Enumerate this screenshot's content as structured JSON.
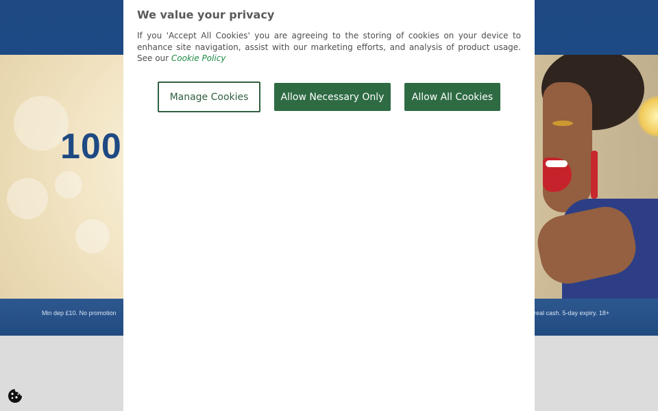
{
  "hero": {
    "amount_fragment": "100",
    "legal_left": "Min dep £10. No promotion",
    "legal_right": "real cash. 5-day expiry. 18+"
  },
  "dialog": {
    "title": "We value your privacy",
    "body": "If you 'Accept All Cookies' you are agreeing to the storing of cookies on your device to enhance site navigation, assist with our marketing efforts, and analysis of product usage. See our",
    "link": "Cookie Policy",
    "buttons": {
      "manage": "Manage Cookies",
      "necessary": "Allow Necessary Only",
      "all": "Allow All Cookies"
    }
  },
  "icons": {
    "cookie_settings": "cookie-icon"
  },
  "colors": {
    "primary_green": "#2e6b43",
    "link_green": "#1d8a43",
    "header_blue": "#0b3a78"
  }
}
